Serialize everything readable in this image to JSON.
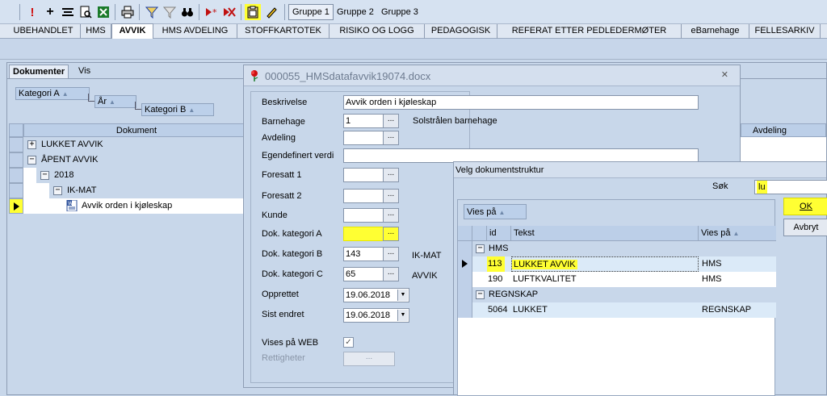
{
  "toolbar": {
    "buttons": [
      {
        "name": "exclamation-icon",
        "glyph": "!",
        "color": "#d01010"
      },
      {
        "name": "add-icon",
        "glyph": "+",
        "color": "#000000"
      },
      {
        "name": "properties-icon",
        "glyph": "",
        "color": "#000000"
      },
      {
        "name": "print-preview-icon",
        "glyph": "",
        "color": "#000000"
      },
      {
        "name": "excel-icon",
        "glyph": "",
        "color": "#1a7a2a"
      },
      {
        "name": "printer-icon",
        "glyph": "",
        "color": "#000000"
      },
      {
        "name": "filter-icon",
        "glyph": "",
        "color": "#2040a0"
      },
      {
        "name": "filter-clear-icon",
        "glyph": "",
        "color": "#808080"
      },
      {
        "name": "binoculars-icon",
        "glyph": "",
        "color": "#000000"
      },
      {
        "name": "mark-icon",
        "glyph": "",
        "color": "#c01010"
      },
      {
        "name": "unmark-icon",
        "glyph": "",
        "color": "#c01010"
      },
      {
        "name": "clipboard-icon",
        "glyph": "",
        "color": "#000000"
      },
      {
        "name": "pencil-icon",
        "glyph": "",
        "color": "#000000"
      }
    ],
    "groups": [
      "Gruppe 1",
      "Gruppe 2",
      "Gruppe 3"
    ]
  },
  "tabs": [
    "UBEHANDLET",
    "HMS",
    "AVVIK",
    "HMS AVDELING",
    "STOFFKARTOTEK",
    "RISIKO OG LOGG",
    "PEDAGOGISK",
    "REFERAT ETTER PEDLEDERMØTER",
    "eBarnehage",
    "FELLESARKIV"
  ],
  "left": {
    "tabs": [
      "Dokumenter",
      "Vis"
    ],
    "groups": [
      "Kategori A",
      "År",
      "Kategori B"
    ],
    "columns": {
      "document": "Dokument",
      "avdeling": "Avdeling"
    },
    "tree": [
      {
        "text": "LUKKET AVVIK",
        "expander": "+"
      },
      {
        "text": "ÅPENT AVVIK",
        "expander": "−"
      },
      {
        "text": "2018",
        "expander": "−"
      },
      {
        "text": "IK-MAT",
        "expander": "−"
      },
      {
        "text": "Avvik orden i kjøleskap",
        "expander": ""
      }
    ]
  },
  "doc_dialog": {
    "title": "000055_HMSdatafavvik19074.docx",
    "close": "✕",
    "fields": {
      "beskrivelse": {
        "label": "Beskrivelse",
        "value": "Avvik orden i kjøleskap"
      },
      "barnehage": {
        "label": "Barnehage",
        "value": "1",
        "extra": "Solstrålen barnehage"
      },
      "avdeling": {
        "label": "Avdeling",
        "value": ""
      },
      "egendefinert": {
        "label": "Egendefinert verdi",
        "value": ""
      },
      "foresatt1": {
        "label": "Foresatt 1",
        "value": ""
      },
      "foresatt2": {
        "label": "Foresatt 2",
        "value": ""
      },
      "kunde": {
        "label": "Kunde",
        "value": ""
      },
      "dokA": {
        "label": "Dok. kategori A",
        "value": ""
      },
      "dokB": {
        "label": "Dok. kategori B",
        "value": "143",
        "extra": "IK-MAT"
      },
      "dokC": {
        "label": "Dok. kategori C",
        "value": "65",
        "extra": "AVVIK"
      },
      "opprettet": {
        "label": "Opprettet",
        "value": "19.06.2018"
      },
      "sist_endret": {
        "label": "Sist endret",
        "value": "19.06.2018"
      },
      "vises_web": {
        "label": "Vises på WEB",
        "checked": "✓"
      },
      "rettigheter": {
        "label": "Rettigheter"
      }
    },
    "dotdot": "..."
  },
  "struct_dialog": {
    "title": "Velg dokumentstruktur",
    "search_label": "Søk",
    "search_value": "lu",
    "ok": "OK",
    "cancel": "Avbryt",
    "vies_pa_group": "Vies på",
    "columns": {
      "id": "id",
      "tekst": "Tekst",
      "vies": "Vies på"
    },
    "groups": [
      {
        "name": "HMS",
        "rows": [
          {
            "id": "113",
            "tekst": "LUKKET AVVIK",
            "vies": "HMS"
          },
          {
            "id": "190",
            "tekst": "LUFTKVALITET",
            "vies": "HMS"
          }
        ]
      },
      {
        "name": "REGNSKAP",
        "rows": [
          {
            "id": "5064",
            "tekst": "LUKKET",
            "vies": "REGNSKAP"
          }
        ]
      }
    ]
  },
  "colors": {
    "highlight": "#ffff33",
    "panel": "#c8d7ea",
    "accent": "#d01010"
  }
}
